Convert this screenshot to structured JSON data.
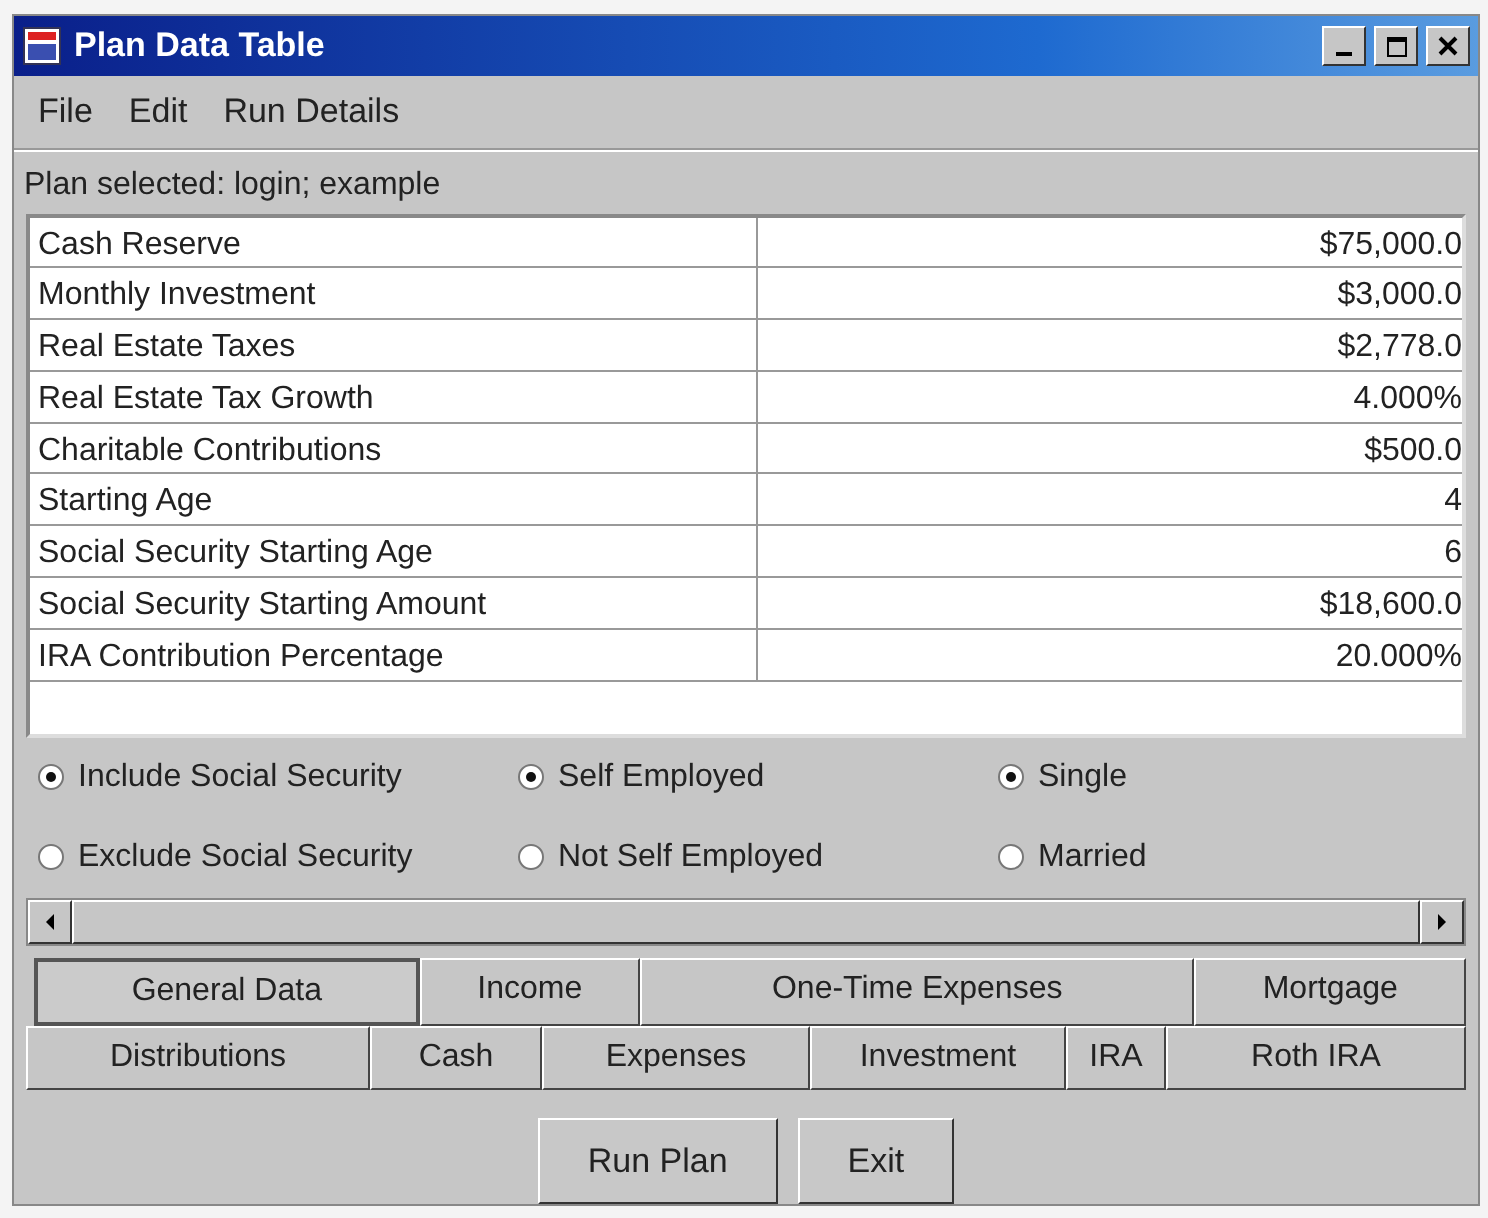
{
  "window": {
    "title": "Plan Data Table"
  },
  "menu": [
    "File",
    "Edit",
    "Run Details"
  ],
  "status": "Plan selected: login; example",
  "table": {
    "rows": [
      {
        "label": "Cash Reserve",
        "value": "$75,000.0"
      },
      {
        "label": "Monthly Investment",
        "value": "$3,000.0"
      },
      {
        "label": "Real Estate Taxes",
        "value": "$2,778.0"
      },
      {
        "label": "Real Estate Tax Growth",
        "value": "4.000%"
      },
      {
        "label": "Charitable Contributions",
        "value": "$500.0"
      },
      {
        "label": "Starting Age",
        "value": "4"
      },
      {
        "label": "Social Security Starting Age",
        "value": "6"
      },
      {
        "label": "Social Security Starting Amount",
        "value": "$18,600.0"
      },
      {
        "label": "IRA Contribution Percentage",
        "value": "20.000%"
      }
    ]
  },
  "radio_groups": [
    [
      {
        "label": "Include Social Security",
        "selected": true
      },
      {
        "label": "Exclude Social Security",
        "selected": false
      }
    ],
    [
      {
        "label": "Self Employed",
        "selected": true
      },
      {
        "label": "Not Self Employed",
        "selected": false
      }
    ],
    [
      {
        "label": "Single",
        "selected": true
      },
      {
        "label": "Married",
        "selected": false
      }
    ]
  ],
  "tab_rows": [
    [
      {
        "label": "General Data",
        "selected": true
      },
      {
        "label": "Income",
        "selected": false
      },
      {
        "label": "One-Time Expenses",
        "selected": false
      },
      {
        "label": "Mortgage",
        "selected": false
      }
    ],
    [
      {
        "label": "Distributions",
        "selected": false
      },
      {
        "label": "Cash",
        "selected": false
      },
      {
        "label": "Expenses",
        "selected": false
      },
      {
        "label": "Investment",
        "selected": false
      },
      {
        "label": "IRA",
        "selected": false
      },
      {
        "label": "Roth IRA",
        "selected": false
      }
    ]
  ],
  "buttons": [
    "Run Plan",
    "Exit"
  ]
}
